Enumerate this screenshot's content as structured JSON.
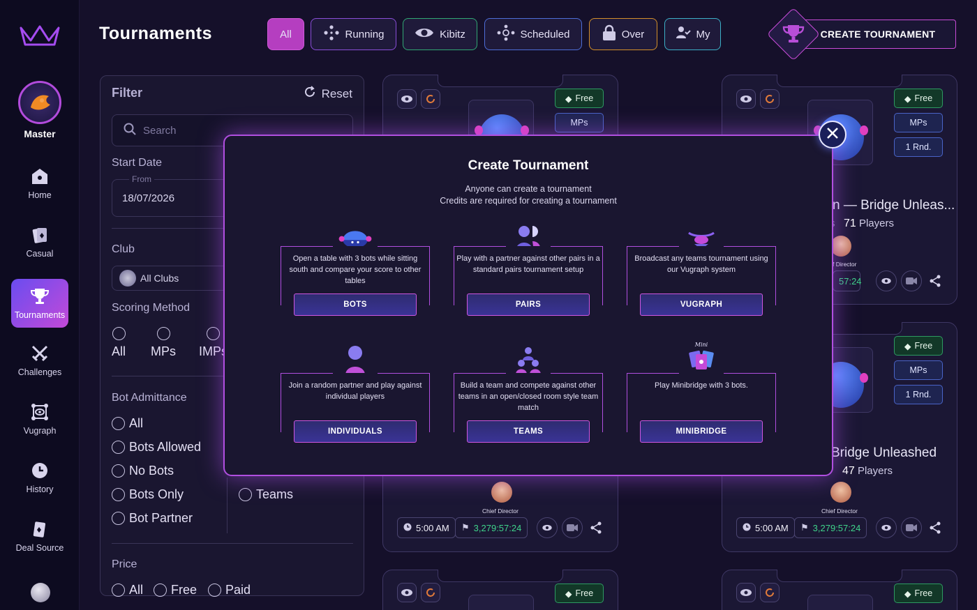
{
  "page": {
    "title": "Tournaments"
  },
  "sidebar": {
    "profile": {
      "label": "Master"
    },
    "items": [
      {
        "label": "Home",
        "icon": "home-icon"
      },
      {
        "label": "Casual",
        "icon": "cards-icon"
      },
      {
        "label": "Tournaments",
        "icon": "trophy-icon",
        "active": true
      },
      {
        "label": "Challenges",
        "icon": "swords-icon"
      },
      {
        "label": "Vugraph",
        "icon": "vugraph-icon"
      },
      {
        "label": "History",
        "icon": "clock-icon"
      },
      {
        "label": "Deal Source",
        "icon": "deal-icon"
      }
    ]
  },
  "tabs": [
    {
      "label": "All",
      "active": true
    },
    {
      "label": "Running",
      "icon": "dots-icon"
    },
    {
      "label": "Kibitz",
      "icon": "eye-icon"
    },
    {
      "label": "Scheduled",
      "icon": "nodes-icon"
    },
    {
      "label": "Over",
      "icon": "lock-icon"
    },
    {
      "label": "My",
      "icon": "user-check-icon"
    }
  ],
  "create_button": {
    "label": "CREATE TOURNAMENT"
  },
  "filter": {
    "title": "Filter",
    "reset": "Reset",
    "search_placeholder": "Search",
    "start_date_label": "Start Date",
    "from_label": "From",
    "from_value": "18/07/2026",
    "club_label": "Club",
    "club_value": "All Clubs",
    "scoring_label": "Scoring Method",
    "scoring_options": [
      "All",
      "MPs",
      "IMPs"
    ],
    "bot_label": "Bot Admittance",
    "bot_options": [
      "All",
      "Bots Allowed",
      "No Bots",
      "Bots Only",
      "Bot Partner"
    ],
    "type_visible_option": "Teams",
    "price_label": "Price",
    "price_options": [
      "All",
      "Free",
      "Paid"
    ]
  },
  "cards": {
    "common": {
      "free": "Free",
      "mps": "MPs",
      "rnd": "1 Rnd.",
      "director": "Chief Director",
      "time": "5:00 AM",
      "clock": "3,279:57:24",
      "players_word": "Players"
    },
    "top_right": {
      "title_fragment": "n — Bridge Unleas...",
      "players": "71",
      "director_fragment": "f Director",
      "clock_fragment": "57:24",
      "s_fragment": "s"
    },
    "mid_right": {
      "title_fragment": "Bridge Unleashed",
      "players": "47"
    }
  },
  "modal": {
    "title": "Create Tournament",
    "subtitle1": "Anyone can create a tournament",
    "subtitle2": "Credits are required for creating a tournament",
    "options": [
      {
        "desc": "Open a table with 3 bots while sitting south and compare your score to other tables",
        "button": "BOTS",
        "icon": "robot-icon"
      },
      {
        "desc": "Play with a partner against other pairs in a standard pairs tournament setup",
        "button": "PAIRS",
        "icon": "pair-icon"
      },
      {
        "desc": "Broadcast any teams tournament using our Vugraph system",
        "button": "VUGRAPH",
        "icon": "broadcast-icon"
      },
      {
        "desc": "Join a random partner and play against individual players",
        "button": "INDIVIDUALS",
        "icon": "person-icon"
      },
      {
        "desc": "Build a team and compete against other teams in an open/closed room style team match",
        "button": "TEAMS",
        "icon": "team-icon"
      },
      {
        "desc": "Play Minibridge with 3 bots.",
        "button": "MINIBRIDGE",
        "icon": "minibridge-icon",
        "badge": "Mini"
      }
    ]
  },
  "colors": {
    "accent": "#b14fe0",
    "active_nav": "#6a4cf0",
    "free_green": "#2e9a62",
    "clock_green": "#3fd38a"
  }
}
